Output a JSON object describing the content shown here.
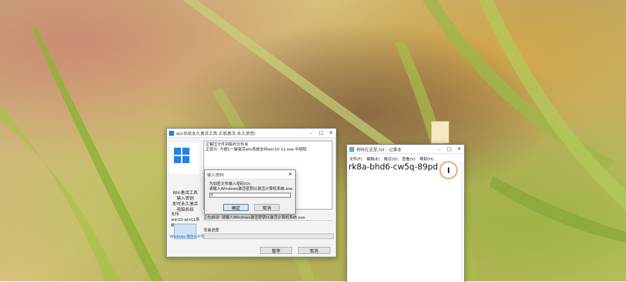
{
  "tool": {
    "title": "win系统永久激活工具-正版激活-永久使用!",
    "side": {
      "name_line1": "Win激活工具",
      "name_line2": "输入密钥",
      "name_line3": "即可永久激活",
      "name_line4": "电脑系统",
      "support_label": "支持:",
      "support_value": "win10-win11系统",
      "footer_badge": "Windows 微信公众号"
    },
    "log_line1": "正解压文件到临时文件夹",
    "log_line2": "正提示: 方便1一键激活win系统支持win10-11.exe 中提取",
    "status_text": "正在启动: 请输入Windows激活密钥以激活计算机系统.exe",
    "progress_label": "安装进度",
    "progress_fraction": 0.0,
    "pause_label": "暂停",
    "cancel_label": "取消"
  },
  "dialog": {
    "title": "输入密码",
    "prompt_line1": "为加密文件输入密码(O):",
    "prompt_line2": "请输入Windows激活密钥以激活计算机系统.exe",
    "input_value": "0",
    "ok_label": "确定",
    "cancel_label": "取消"
  },
  "notepad": {
    "title": "密码在这里.txt - 记事本",
    "menu": [
      "文件(F)",
      "编辑(E)",
      "格式(O)",
      "查看(V)",
      "帮助(H)"
    ],
    "content": "rk8a-bhd6-cw5q-89pd",
    "cursor_glyph": "I"
  },
  "icons": {
    "minimize": "minimize-icon",
    "maximize": "maximize-icon",
    "close": "close-icon",
    "windows_logo": "windows-logo-icon",
    "laptop": "laptop-icon",
    "text_cursor": "text-cursor-icon",
    "folder": "folder-icon"
  },
  "colors": {
    "accent": "#1e86e0",
    "cursor_ring": "#f0a76a",
    "progress": "#06b025"
  }
}
